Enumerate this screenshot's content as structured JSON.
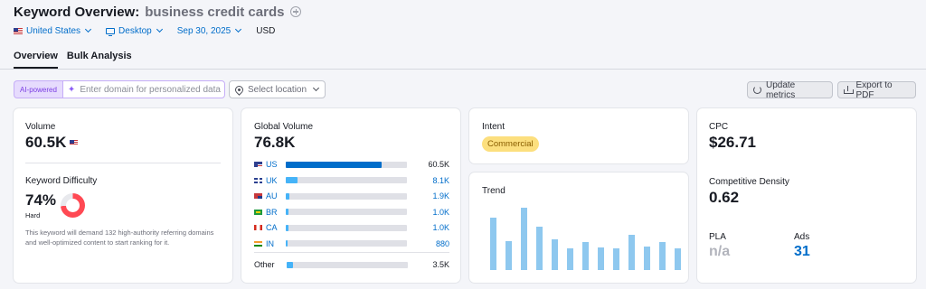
{
  "header": {
    "title": "Keyword Overview:",
    "keyword": "business credit cards"
  },
  "filters": {
    "country": "United States",
    "device": "Desktop",
    "date": "Sep 30, 2025",
    "currency": "USD"
  },
  "tabs": [
    {
      "label": "Overview",
      "active": true
    },
    {
      "label": "Bulk Analysis",
      "active": false
    }
  ],
  "toolbar": {
    "ai_badge": "AI-powered",
    "domain_placeholder": "Enter domain for personalized data",
    "location_placeholder": "Select location",
    "update_label": "Update metrics",
    "export_label": "Export to PDF"
  },
  "volume": {
    "label": "Volume",
    "value": "60.5K"
  },
  "kd": {
    "label": "Keyword Difficulty",
    "value": "74%",
    "level": "Hard",
    "percent": 74,
    "description": "This keyword will demand 132 high-authority referring domains and well-optimized content to start ranking for it."
  },
  "global_volume": {
    "label": "Global Volume",
    "value": "76.8K",
    "rows": [
      {
        "code": "US",
        "value": "60.5K",
        "fraction": 0.79,
        "flag": "flag-us",
        "color": "#006dca",
        "dark": true
      },
      {
        "code": "UK",
        "value": "8.1K",
        "fraction": 0.1,
        "flag": "flag-uk",
        "color": "#45b3f8",
        "dark": false
      },
      {
        "code": "AU",
        "value": "1.9K",
        "fraction": 0.03,
        "flag": "flag-au",
        "color": "#45b3f8",
        "dark": false
      },
      {
        "code": "BR",
        "value": "1.0K",
        "fraction": 0.02,
        "flag": "flag-br",
        "color": "#45b3f8",
        "dark": false
      },
      {
        "code": "CA",
        "value": "1.0K",
        "fraction": 0.02,
        "flag": "flag-ca",
        "color": "#45b3f8",
        "dark": false
      },
      {
        "code": "IN",
        "value": "880",
        "fraction": 0.015,
        "flag": "flag-in",
        "color": "#45b3f8",
        "dark": false
      }
    ],
    "other": {
      "code": "Other",
      "value": "3.5K",
      "fraction": 0.05,
      "color": "#45b3f8"
    }
  },
  "intent": {
    "label": "Intent",
    "value": "Commercial"
  },
  "trend": {
    "label": "Trend",
    "values": [
      0.72,
      0.4,
      0.86,
      0.6,
      0.43,
      0.3,
      0.39,
      0.31,
      0.3,
      0.49,
      0.32,
      0.39,
      0.3
    ]
  },
  "cpc": {
    "label": "CPC",
    "value": "$26.71"
  },
  "competitive_density": {
    "label": "Competitive Density",
    "value": "0.62"
  },
  "pla": {
    "label": "PLA",
    "value": "n/a"
  },
  "ads": {
    "label": "Ads",
    "value": "31"
  }
}
